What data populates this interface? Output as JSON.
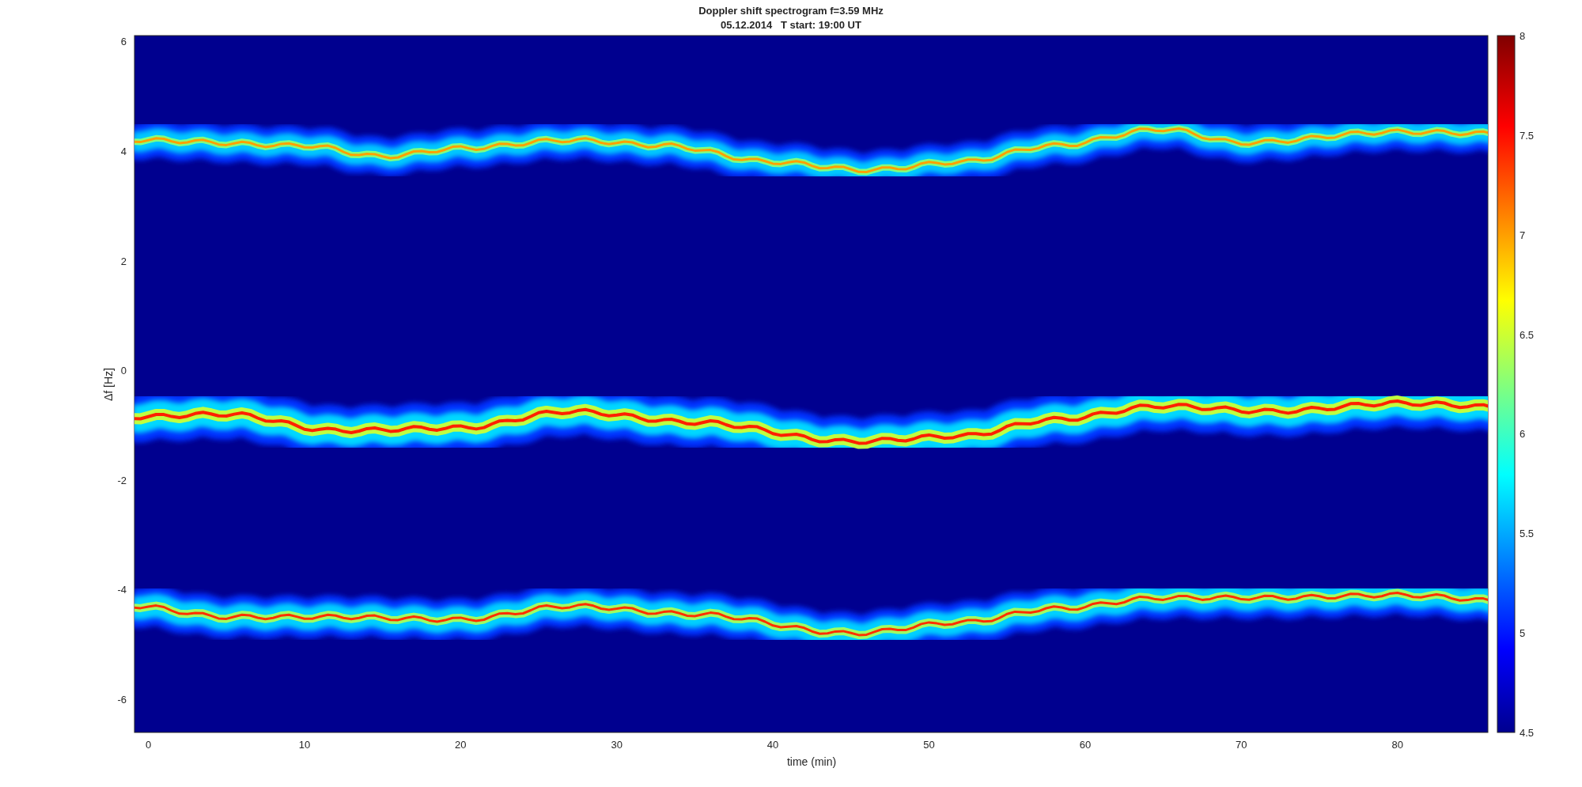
{
  "figure": {
    "title": "Doppler shift spectrogram f=3.59 MHz",
    "subtitle": "05.12.2014   T start: 19:00 UT",
    "xlabel": "time (min)",
    "ylabel": "Δf [Hz]",
    "xticks": [
      "0",
      "10",
      "20",
      "30",
      "40",
      "50",
      "60",
      "70",
      "80"
    ],
    "yticks": [
      "6",
      "4",
      "2",
      "0",
      "-2",
      "-4",
      "-6"
    ],
    "colorbar_ticks": [
      "8",
      "7.5",
      "7",
      "6.5",
      "6",
      "5.5",
      "5",
      "4.5"
    ]
  }
}
